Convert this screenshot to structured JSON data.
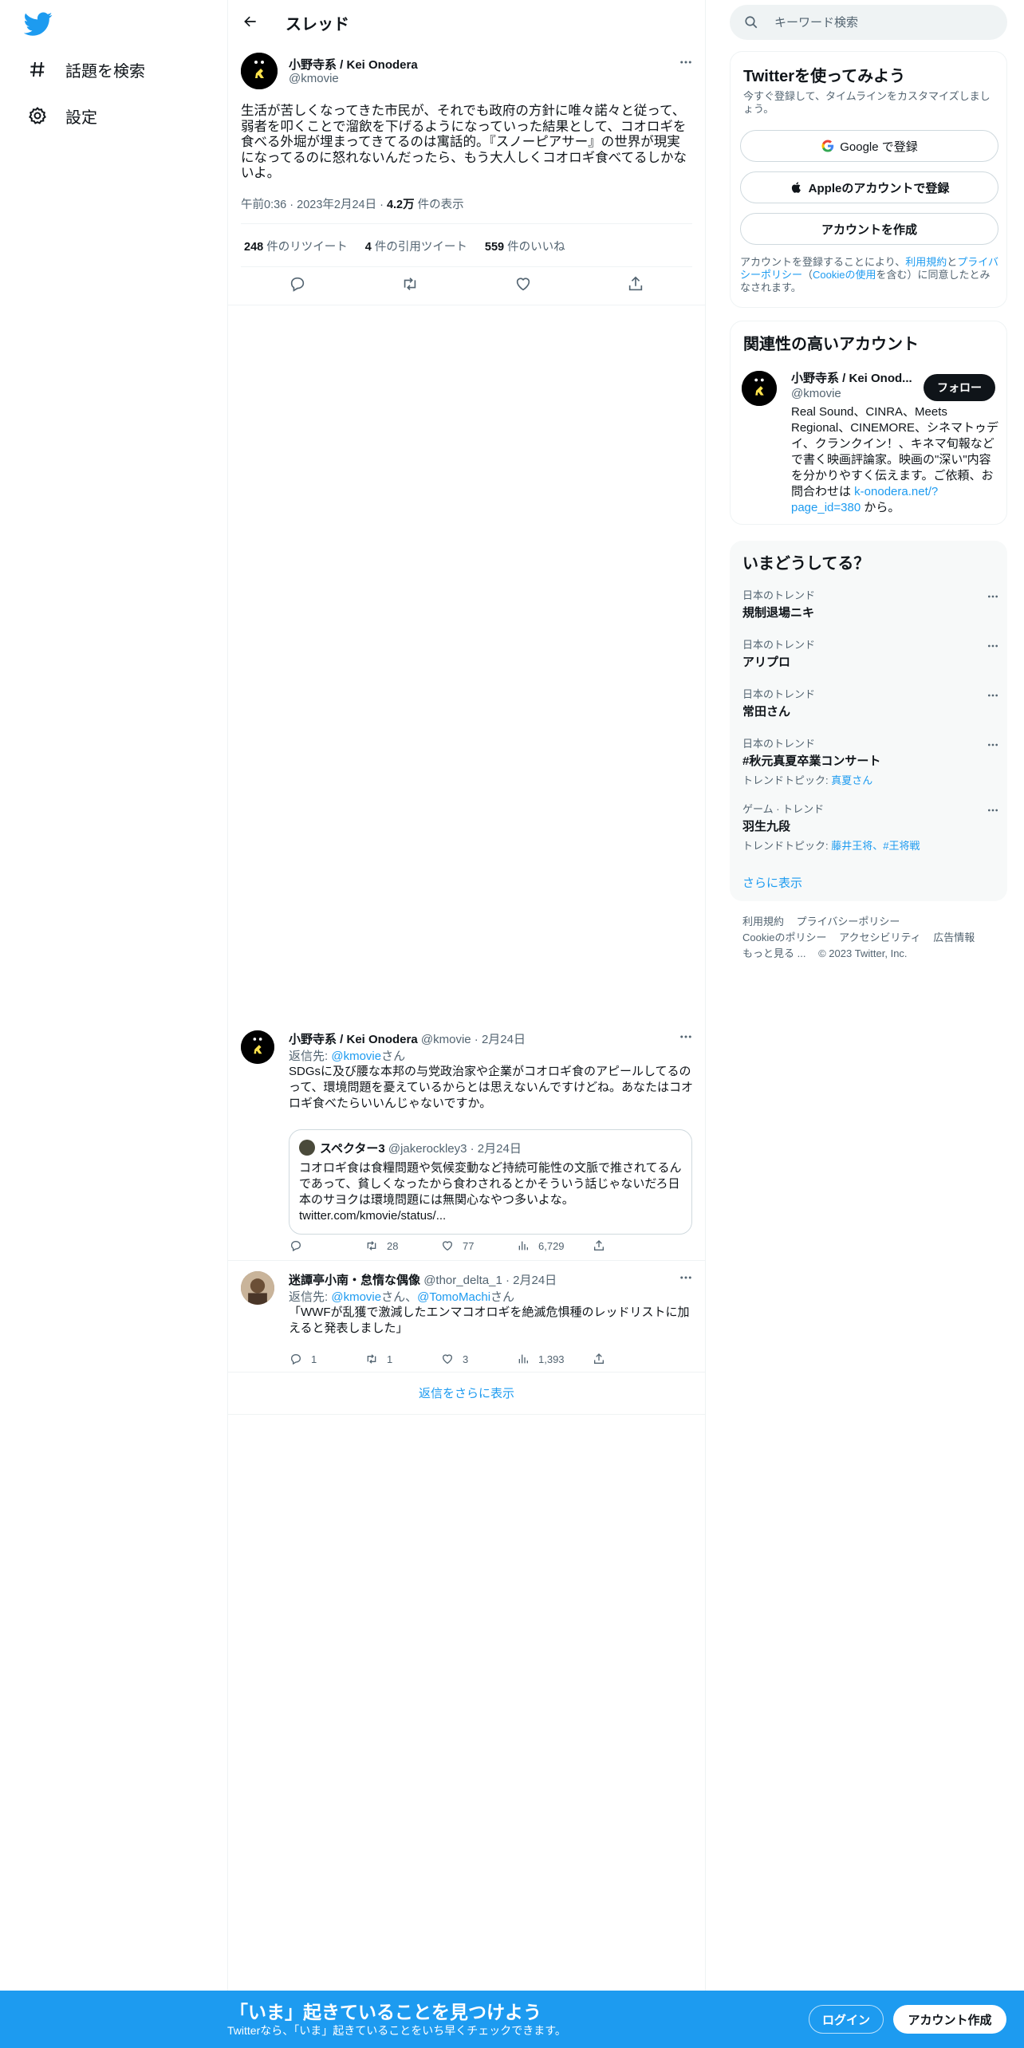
{
  "nav": {
    "explore_label": "話題を検索",
    "settings_label": "設定"
  },
  "header": {
    "title": "スレッド"
  },
  "focal": {
    "name": "小野寺系 / Kei Onodera",
    "handle": "@kmovie",
    "text": "生活が苦しくなってきた市民が、それでも政府の方針に唯々諾々と従って、弱者を叩くことで溜飲を下げるようになっていった結果として、コオロギを食べる外堀が埋まってきてるのは寓話的。『スノーピアサー』の世界が現実になってるのに怒れないんだったら、もう大人しくコオロギ食べてるしかないよ。",
    "time": "午前0:36",
    "date": "2023年2月24日",
    "views_count": "4.2万",
    "views_label": "件の表示",
    "retweets_count": "248",
    "retweets_label": "件のリツイート",
    "quotes_count": "4",
    "quotes_label": "件の引用ツイート",
    "likes_count": "559",
    "likes_label": "件のいいね"
  },
  "replies": [
    {
      "name": "小野寺系 / Kei Onodera",
      "meta": "@kmovie · 2月24日",
      "replyto_prefix": "返信先: ",
      "replyto_handle": "@kmovie",
      "replyto_suffix": "さん",
      "text": "SDGsに及び腰な本邦の与党政治家や企業がコオロギ食のアピールしてるのって、環境問題を憂えているからとは思えないんですけどね。あなたはコオロギ食べたらいいんじゃないですか。",
      "quote": {
        "name": "スペクター3",
        "meta": "@jakerockley3 · 2月24日",
        "text": "コオロギ食は食糧問題や気候変動など持続可能性の文脈で推されてるんであって、貧しくなったから食わされるとかそういう話じゃないだろ日本のサヨクは環境問題には無関心なやつ多いよな。",
        "link": "twitter.com/kmovie/status/..."
      },
      "retweets": "28",
      "likes": "77",
      "views": "6,729"
    },
    {
      "name": "迷譚亭小南・怠惰な偶像",
      "meta": "@thor_delta_1 · 2月24日",
      "replyto_prefix": "返信先: ",
      "replyto_handle": "@kmovie",
      "replyto_mid": "さん、",
      "replyto_handle2": "@TomoMachi",
      "replyto_suffix": "さん",
      "text": "「WWFが乱獲で激減したエンマコオロギを絶滅危惧種のレッドリストに加えると発表しました」",
      "replies": "1",
      "retweets": "1",
      "likes": "3",
      "views": "1,393"
    }
  ],
  "show_more_replies": "返信をさらに表示",
  "sidebar": {
    "search_placeholder": "キーワード検索",
    "signup": {
      "title": "Twitterを使ってみよう",
      "sub": "今すぐ登録して、タイムラインをカスタマイズしましょう。",
      "google": "Google で登録",
      "apple": "Appleのアカウントで登録",
      "create": "アカウントを作成",
      "legal_1": "アカウントを登録することにより、",
      "legal_terms": "利用規約",
      "legal_2": "と",
      "legal_privacy": "プライバシーポリシー",
      "legal_3": "（",
      "legal_cookie": "Cookieの使用",
      "legal_4": "を含む）に同意したとみなされます。"
    },
    "related": {
      "title": "関連性の高いアカウント",
      "name": "小野寺系 / Kei Onod...",
      "handle": "@kmovie",
      "follow": "フォロー",
      "bio": "Real Sound、CINRA、Meets Regional、CINEMORE、シネマトゥデイ、クランクイン！、キネマ旬報などで書く映画評論家。映画の\"深い\"内容を分かりやすく伝えます。ご依頼、お問合わせは ",
      "bio_link": "k-onodera.net/?page_id=380",
      "bio_end": " から。"
    },
    "trends": {
      "title": "いまどうしてる？",
      "items": [
        {
          "category": "日本のトレンド",
          "name": "規制退場ニキ"
        },
        {
          "category": "日本のトレンド",
          "name": "アリプロ"
        },
        {
          "category": "日本のトレンド",
          "name": "常田さん"
        },
        {
          "category": "日本のトレンド",
          "name": "#秋元真夏卒業コンサート",
          "topic_label": "トレンドトピック: ",
          "topic": "真夏さん"
        },
        {
          "category": "ゲーム · トレンド",
          "name": "羽生九段",
          "topic_label": "トレンドトピック: ",
          "topic": "藤井王将、#王将戦"
        }
      ],
      "show_more": "さらに表示"
    },
    "footer": {
      "terms": "利用規約",
      "privacy": "プライバシーポリシー",
      "cookie": "Cookieのポリシー",
      "accessibility": "アクセシビリティ",
      "ads": "広告情報",
      "more": "もっと見る ...",
      "copyright": "© 2023 Twitter, Inc."
    }
  },
  "bottom_bar": {
    "title": "「いま」起きていることを見つけよう",
    "sub": "Twitterなら、「いま」起きていることをいち早くチェックできます。",
    "login": "ログイン",
    "signup": "アカウント作成"
  },
  "colors": {
    "accent": "#1d9bf0",
    "text": "#0f1419",
    "secondary": "#536471",
    "border": "#eff3f4"
  }
}
